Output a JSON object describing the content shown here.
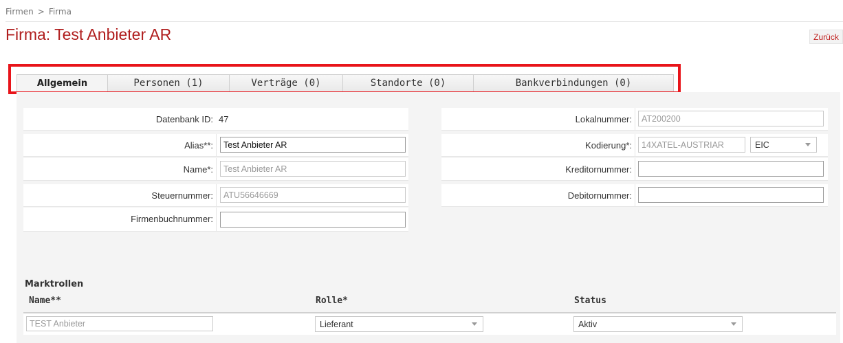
{
  "breadcrumb": {
    "items": [
      "Firmen",
      "Firma"
    ],
    "separator": ">"
  },
  "page": {
    "title": "Firma: Test Anbieter AR",
    "back_label": "Zurück"
  },
  "tabs": [
    {
      "label": "Allgemein",
      "active": true
    },
    {
      "label": "Personen (1)",
      "active": false
    },
    {
      "label": "Verträge (0)",
      "active": false
    },
    {
      "label": "Standorte (0)",
      "active": false
    },
    {
      "label": "Bankverbindungen (0)",
      "active": false
    }
  ],
  "form_left": {
    "datenbank_id": {
      "label": "Datenbank ID:",
      "value": "47"
    },
    "alias": {
      "label": "Alias**:",
      "value": "Test Anbieter AR"
    },
    "name": {
      "label": "Name*:",
      "value": "Test Anbieter AR"
    },
    "steuernummer": {
      "label": "Steuernummer:",
      "value": "ATU56646669"
    },
    "firmenbuchnummer": {
      "label": "Firmenbuchnummer:",
      "value": ""
    }
  },
  "form_right": {
    "lokalnummer": {
      "label": "Lokalnummer:",
      "value": "AT200200"
    },
    "kodierung": {
      "label": "Kodierung*:",
      "value": "14XATEL-AUSTRIAR",
      "type_selected": "EIC"
    },
    "kreditornummer": {
      "label": "Kreditornummer:",
      "value": ""
    },
    "debitornummer": {
      "label": "Debitornummer:",
      "value": ""
    }
  },
  "marktrollen": {
    "title": "Marktrollen",
    "columns": [
      "Name**",
      "Rolle*",
      "Status"
    ],
    "rows": [
      {
        "name": "TEST Anbieter",
        "rolle": "Lieferant",
        "status": "Aktiv"
      }
    ]
  },
  "colors": {
    "title_red": "#b01e1e",
    "highlight_red": "#e8141a",
    "panel_bg": "#f4f4f4"
  }
}
